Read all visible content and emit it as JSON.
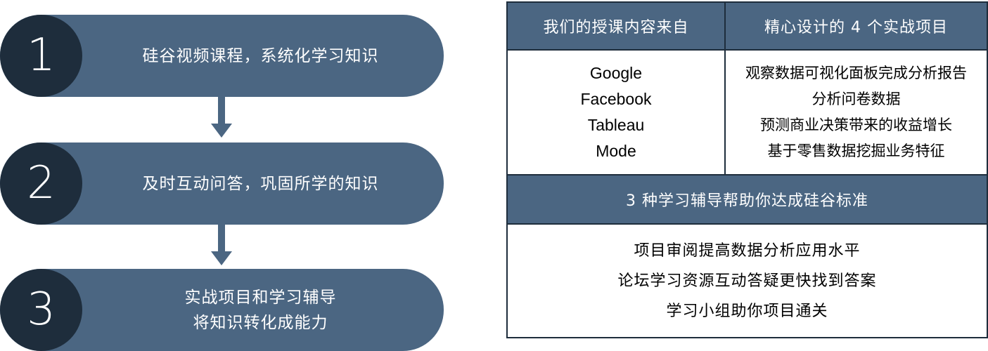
{
  "steps": [
    {
      "number": "1",
      "lines": [
        "硅谷视频课程，系统化学习知识"
      ]
    },
    {
      "number": "2",
      "lines": [
        "及时互动问答，巩固所学的知识"
      ]
    },
    {
      "number": "3",
      "lines": [
        "实战项目和学习辅导",
        "将知识转化成能力"
      ]
    }
  ],
  "table": {
    "header_left": "我们的授课内容来自",
    "header_right": "精心设计的 4 个实战项目",
    "sources": [
      "Google",
      "Facebook",
      "Tableau",
      "Mode"
    ],
    "projects": [
      "观察数据可视化面板完成分析报告",
      "分析问卷数据",
      "预测商业决策带来的收益增长",
      "基于零售数据挖掘业务特征"
    ],
    "coaching_header": "3 种学习辅导帮助你达成硅谷标准",
    "coaching": [
      "项目审阅提高数据分析应用水平",
      "论坛学习资源互动答疑更快找到答案",
      "学习小组助你项目通关"
    ]
  },
  "colors": {
    "pill": "#4b6682",
    "badge": "#1e2d3c",
    "header": "#4b6682"
  }
}
